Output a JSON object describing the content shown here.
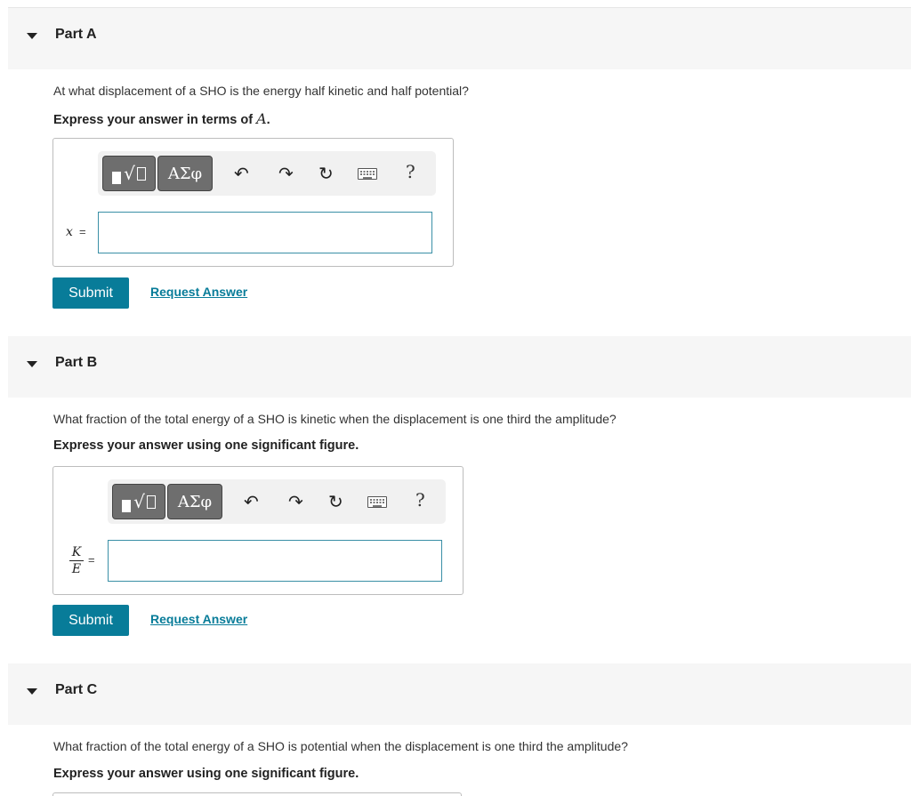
{
  "parts": [
    {
      "title": "Part A",
      "question": "At what displacement of a SHO is the energy half kinetic and half potential?",
      "instruction_prefix": "Express your answer in terms of ",
      "instruction_var": "A",
      "instruction_suffix": ".",
      "answer_label": "x",
      "equals": "=",
      "answer_value": "",
      "submit_label": "Submit",
      "request_label": "Request Answer"
    },
    {
      "title": "Part B",
      "question": "What fraction of the total energy of a SHO is kinetic when the displacement is one third the amplitude?",
      "instruction": "Express your answer using one significant figure.",
      "answer_label_num": "K",
      "answer_label_den": "E",
      "equals": "=",
      "answer_value": "",
      "submit_label": "Submit",
      "request_label": "Request Answer"
    },
    {
      "title": "Part C",
      "question": "What fraction of the total energy of a SHO is potential when the displacement is one third the amplitude?",
      "instruction": "Express your answer using one significant figure."
    }
  ],
  "toolbar": {
    "templates_icon": "templates-icon",
    "greek_label": "ΑΣφ",
    "undo_icon": "undo-icon",
    "redo_icon": "redo-icon",
    "reset_icon": "reset-icon",
    "keyboard_icon": "keyboard-icon",
    "help_label": "?"
  },
  "colors": {
    "accent": "#087c99",
    "header_bg": "#f6f6f6",
    "toolbar_bg": "#f1f1f1",
    "toolbar_button": "#6e6e6e",
    "input_border": "#3a8fa6"
  }
}
